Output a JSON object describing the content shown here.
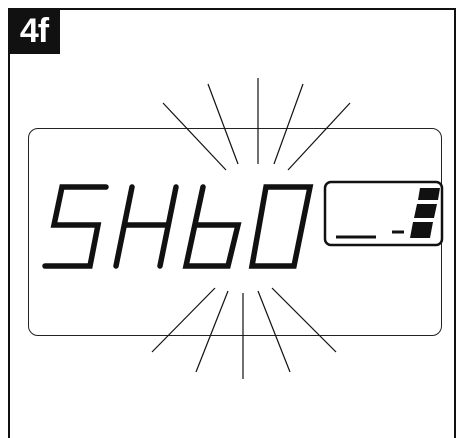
{
  "figure": {
    "step_label": "4f"
  },
  "display": {
    "text": "SHb0",
    "state": "blinking",
    "battery_segments_filled": 3
  },
  "colors": {
    "ink": "#111111",
    "background": "#ffffff"
  }
}
